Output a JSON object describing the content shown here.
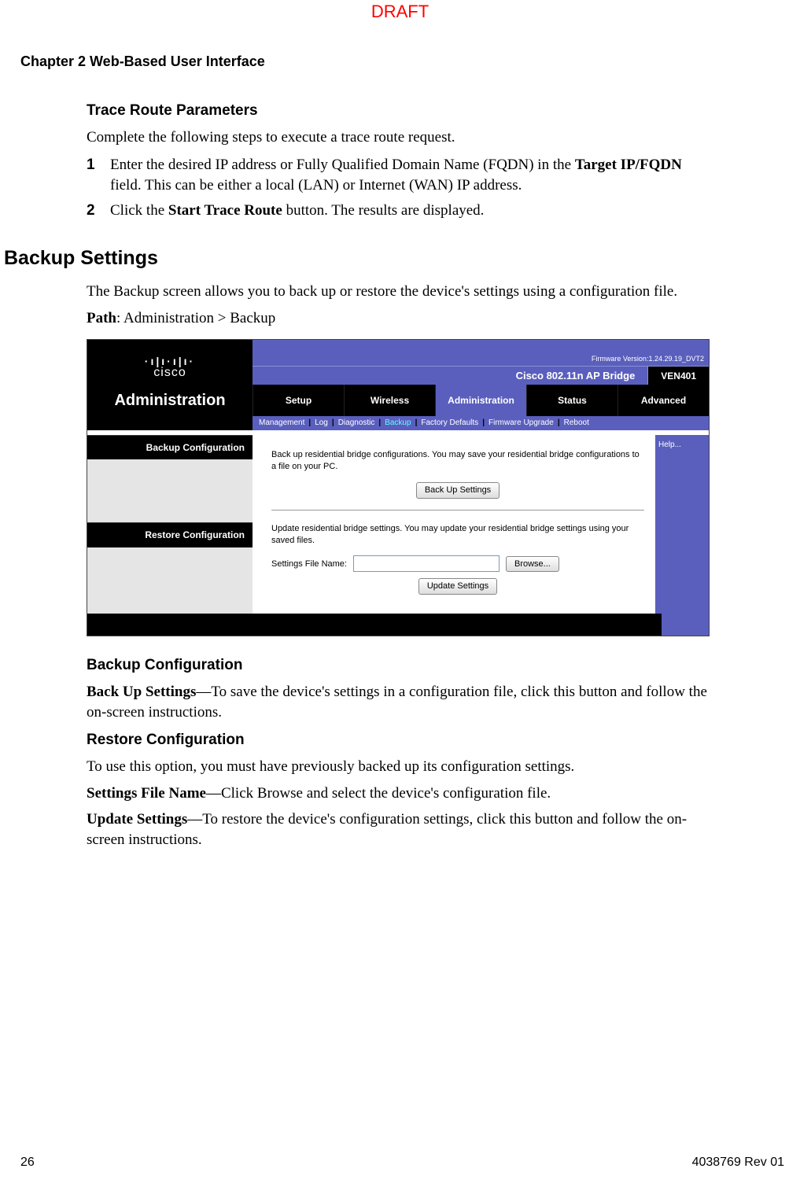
{
  "meta": {
    "draft_label": "DRAFT",
    "chapter": "Chapter 2    Web-Based User Interface",
    "page_number": "26",
    "doc_id": "4038769 Rev 01"
  },
  "section_trace": {
    "heading": "Trace Route Parameters",
    "intro": "Complete the following steps to execute a trace route request.",
    "steps": [
      {
        "num": "1",
        "text_a": "Enter the desired IP address or Fully Qualified Domain Name (FQDN) in the ",
        "bold": "Target IP/FQDN",
        "text_b": " field. This can be either a local (LAN) or Internet (WAN) IP address."
      },
      {
        "num": "2",
        "text_a": "Click the ",
        "bold": "Start Trace Route",
        "text_b": " button. The results are displayed."
      }
    ]
  },
  "section_backup_heading": "Backup Settings",
  "section_backup_intro": "The Backup screen allows you to back up or restore the device's settings using a configuration file.",
  "path_label": "Path",
  "path_value": ": Administration > Backup",
  "shot": {
    "firmware": "Firmware Version:1.24.29.19_DVT2",
    "product_title": "Cisco 802.11n AP Bridge",
    "model": "VEN401",
    "section_name": "Administration",
    "logo_word": "cisco",
    "tabs": [
      "Setup",
      "Wireless",
      "Administration",
      "Status",
      "Advanced"
    ],
    "active_tab_index": 2,
    "subnav": [
      "Management",
      "Log",
      "Diagnostic",
      "Backup",
      "Factory Defaults",
      "Firmware Upgrade",
      "Reboot"
    ],
    "subnav_active_index": 3,
    "left_labels": [
      "Backup Configuration",
      "Restore Configuration"
    ],
    "backup_text": "Back up residential bridge configurations. You may save your residential bridge configurations to a file on your PC.",
    "backup_button": "Back Up Settings",
    "restore_text": "Update residential bridge settings. You may update your residential bridge settings using your saved files.",
    "file_label": "Settings File Name:",
    "browse_button": "Browse...",
    "update_button": "Update Settings",
    "help_label": "Help..."
  },
  "section_backup_conf": {
    "heading": "Backup Configuration",
    "bold1": "Back Up Settings",
    "text1": "—To save the device's settings in a configuration file, click this button and follow the on-screen instructions."
  },
  "section_restore_conf": {
    "heading": "Restore Configuration",
    "intro": "To use this option, you must have previously backed up its configuration settings.",
    "bold2": "Settings File Name",
    "text2": "—Click Browse and select the device's configuration file.",
    "bold3": "Update Settings",
    "text3": "—To restore the device's configuration settings, click this button and follow the on-screen instructions."
  }
}
